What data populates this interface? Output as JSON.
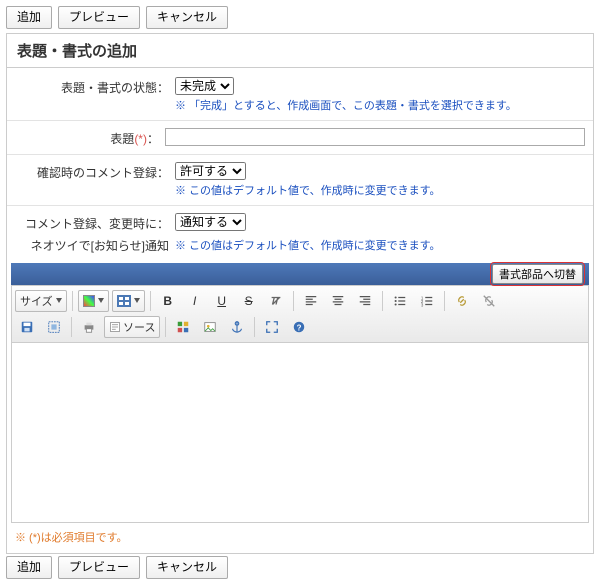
{
  "top_buttons": {
    "add": "追加",
    "preview": "プレビュー",
    "cancel": "キャンセル"
  },
  "panel_title": "表題・書式の追加",
  "status": {
    "label": "表題・書式の状態：",
    "selected": "未完成",
    "hint": "※ 「完成」とすると、作成画面で、この表題・書式を選択できます。"
  },
  "title_field": {
    "label": "表題",
    "req": "(*)",
    "colon": "：",
    "value": ""
  },
  "confirm_comment": {
    "label": "確認時のコメント登録：",
    "selected": "許可する",
    "hint": "※ この値はデフォルト値で、作成時に変更できます。"
  },
  "change_notify": {
    "label": "コメント登録、変更時に：",
    "selected": "通知する"
  },
  "neotwi": {
    "label": "ネオツイで[お知らせ]通知",
    "hint": "※ この値はデフォルト値で、作成時に変更できます。"
  },
  "editor": {
    "switch_btn": "書式部品へ切替",
    "size_label": "サイズ",
    "source_label": "ソース",
    "icons": {
      "text_color": "text-color-icon",
      "table": "table-icon",
      "bold": "bold-icon",
      "italic": "italic-icon",
      "underline": "underline-icon",
      "strike": "strike-icon",
      "remove_format": "remove-format-icon",
      "align_left": "align-left-icon",
      "align_center": "align-center-icon",
      "align_right": "align-right-icon",
      "ul": "bullet-list-icon",
      "ol": "number-list-icon",
      "link": "link-icon",
      "unlink": "unlink-icon",
      "save": "save-icon",
      "select_all": "select-all-icon",
      "print": "print-icon",
      "src": "source-icon",
      "smiley": "smiley-icon",
      "image": "image-icon",
      "anchor": "anchor-icon",
      "maximize": "maximize-icon",
      "help": "help-icon"
    }
  },
  "required_note": "※ (*)は必須項目です。",
  "bottom_buttons": {
    "add": "追加",
    "preview": "プレビュー",
    "cancel": "キャンセル"
  }
}
